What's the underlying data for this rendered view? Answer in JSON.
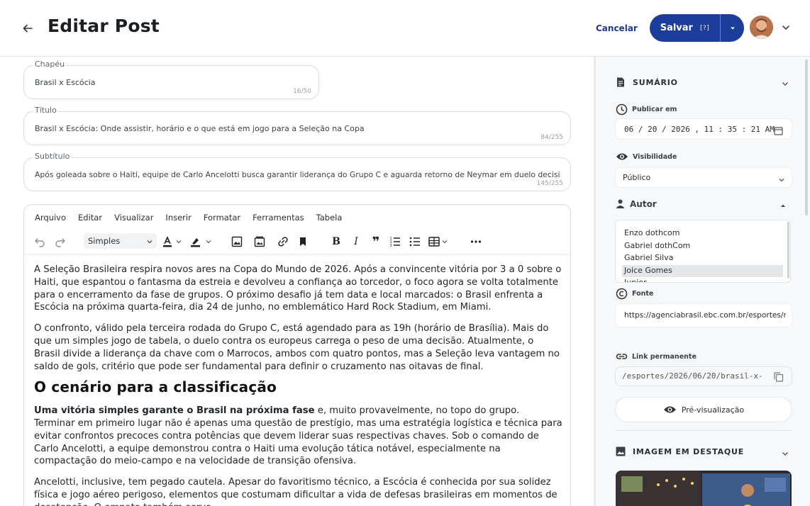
{
  "header": {
    "title": "Editar Post",
    "cancel_label": "Cancelar",
    "save_label": "Salvar",
    "save_shortcut": "[?]"
  },
  "fields": {
    "chapeu": {
      "label": "Chapéu",
      "value": "Brasil x Escócia",
      "counter": "16/50"
    },
    "titulo": {
      "label": "Título",
      "value": "Brasil x Escócia: Onde assistir, horário e o que está em jogo para a Seleção na Copa",
      "counter": "84/255"
    },
    "subtitulo": {
      "label": "Subtítulo",
      "value": "Após goleada sobre o Haiti, equipe de Carlo Ancelotti busca garantir liderança do Grupo C e aguarda retorno de Neymar em duelo decisivo em Miami",
      "counter": "145/255"
    }
  },
  "editor": {
    "menu": [
      "Arquivo",
      "Editar",
      "Visualizar",
      "Inserir",
      "Formatar",
      "Ferramentas",
      "Tabela"
    ],
    "style_select": "Simples",
    "paragraphs": [
      "A Seleção Brasileira respira novos ares na Copa do Mundo de 2026. Após a convincente vitória por 3 a 0 sobre o Haiti, que espantou o fantasma da estreia e devolveu a confiança ao torcedor, o foco agora se volta totalmente para o encerramento da fase de grupos. O próximo desafio já tem data e local marcados: o Brasil enfrenta a Escócia na próxima quarta-feira, dia 24 de junho, no emblemático Hard Rock Stadium, em Miami.",
      "O confronto, válido pela terceira rodada do Grupo C, está agendado para as 19h (horário de Brasília). Mais do que um simples jogo de tabela, o duelo contra os europeus carrega o peso de uma decisão. Atualmente, o Brasil divide a liderança da chave com o Marrocos, ambos com quatro pontos, mas a Seleção leva vantagem no saldo de gols, critério que pode ser fundamental para definir o cruzamento nas oitavas de final."
    ],
    "heading": "O cenário para a classificação",
    "p3_bold": "Uma vitória simples garante o Brasil na próxima fase",
    "p3_rest": " e, muito provavelmente, no topo do grupo. Terminar em primeiro lugar não é apenas uma questão de prestígio, mas uma estratégia logística e técnica para evitar confrontos precoces contra potências que devem liderar suas respectivas chaves. Sob o comando de Carlo Ancelotti, a equipe demonstrou contra o Haiti uma evolução tática notável, especialmente na compactação do meio-campo e na velocidade de transição ofensiva.",
    "p4": "Ancelotti, inclusive, tem pegado cautela. Apesar do favoritismo técnico, a Escócia é conhecida por sua solidez física e jogo aéreo perigoso, elementos que costumam dificultar a vida de defesas brasileiras em momentos de desatenção. O empate também serve"
  },
  "sidebar": {
    "summary_title": "SUMÁRIO",
    "publish_label": "Publicar em",
    "publish_value": "06 / 20 / 2026 ,  11 : 35 : 21   AM",
    "visibility_label": "Visibilidade",
    "visibility_value": "Público",
    "author_title": "Autor",
    "authors": [
      "Enzo dothcom",
      "Gabriel dothCom",
      "Gabriel Silva",
      "Joice Gomes",
      "Junior"
    ],
    "source_label": "Fonte",
    "source_value": "https://agenciabrasil.ebc.com.br/esportes/nc",
    "permalink_label": "Link permanente",
    "permalink_value": "/esportes/2026/06/20/brasil-x-",
    "preview_label": "Pré-visualização",
    "featured_title": "IMAGEM EM DESTAQUE"
  },
  "colors": {
    "primary": "#1d3d9a",
    "cancel_text": "#1f3a8a",
    "sidebar_bg": "#f7f8f9"
  }
}
